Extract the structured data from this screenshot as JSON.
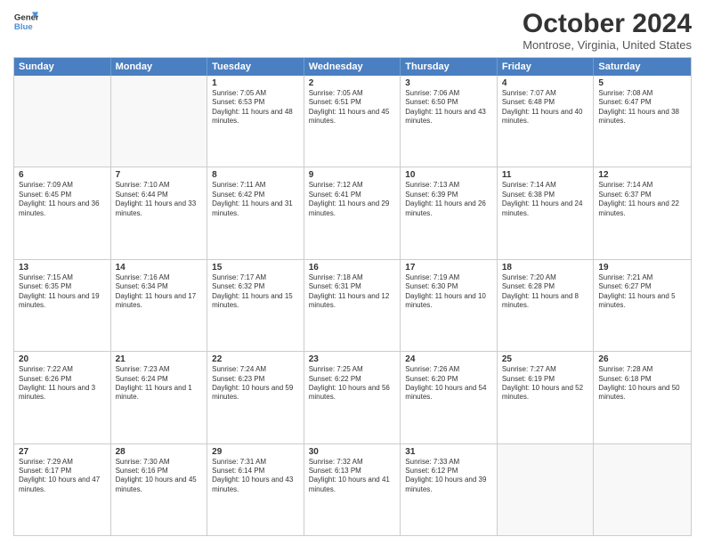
{
  "header": {
    "logo_line1": "General",
    "logo_line2": "Blue",
    "title": "October 2024",
    "subtitle": "Montrose, Virginia, United States"
  },
  "weekdays": [
    "Sunday",
    "Monday",
    "Tuesday",
    "Wednesday",
    "Thursday",
    "Friday",
    "Saturday"
  ],
  "weeks": [
    [
      {
        "day": "",
        "info": ""
      },
      {
        "day": "",
        "info": ""
      },
      {
        "day": "1",
        "info": "Sunrise: 7:05 AM\nSunset: 6:53 PM\nDaylight: 11 hours and 48 minutes."
      },
      {
        "day": "2",
        "info": "Sunrise: 7:05 AM\nSunset: 6:51 PM\nDaylight: 11 hours and 45 minutes."
      },
      {
        "day": "3",
        "info": "Sunrise: 7:06 AM\nSunset: 6:50 PM\nDaylight: 11 hours and 43 minutes."
      },
      {
        "day": "4",
        "info": "Sunrise: 7:07 AM\nSunset: 6:48 PM\nDaylight: 11 hours and 40 minutes."
      },
      {
        "day": "5",
        "info": "Sunrise: 7:08 AM\nSunset: 6:47 PM\nDaylight: 11 hours and 38 minutes."
      }
    ],
    [
      {
        "day": "6",
        "info": "Sunrise: 7:09 AM\nSunset: 6:45 PM\nDaylight: 11 hours and 36 minutes."
      },
      {
        "day": "7",
        "info": "Sunrise: 7:10 AM\nSunset: 6:44 PM\nDaylight: 11 hours and 33 minutes."
      },
      {
        "day": "8",
        "info": "Sunrise: 7:11 AM\nSunset: 6:42 PM\nDaylight: 11 hours and 31 minutes."
      },
      {
        "day": "9",
        "info": "Sunrise: 7:12 AM\nSunset: 6:41 PM\nDaylight: 11 hours and 29 minutes."
      },
      {
        "day": "10",
        "info": "Sunrise: 7:13 AM\nSunset: 6:39 PM\nDaylight: 11 hours and 26 minutes."
      },
      {
        "day": "11",
        "info": "Sunrise: 7:14 AM\nSunset: 6:38 PM\nDaylight: 11 hours and 24 minutes."
      },
      {
        "day": "12",
        "info": "Sunrise: 7:14 AM\nSunset: 6:37 PM\nDaylight: 11 hours and 22 minutes."
      }
    ],
    [
      {
        "day": "13",
        "info": "Sunrise: 7:15 AM\nSunset: 6:35 PM\nDaylight: 11 hours and 19 minutes."
      },
      {
        "day": "14",
        "info": "Sunrise: 7:16 AM\nSunset: 6:34 PM\nDaylight: 11 hours and 17 minutes."
      },
      {
        "day": "15",
        "info": "Sunrise: 7:17 AM\nSunset: 6:32 PM\nDaylight: 11 hours and 15 minutes."
      },
      {
        "day": "16",
        "info": "Sunrise: 7:18 AM\nSunset: 6:31 PM\nDaylight: 11 hours and 12 minutes."
      },
      {
        "day": "17",
        "info": "Sunrise: 7:19 AM\nSunset: 6:30 PM\nDaylight: 11 hours and 10 minutes."
      },
      {
        "day": "18",
        "info": "Sunrise: 7:20 AM\nSunset: 6:28 PM\nDaylight: 11 hours and 8 minutes."
      },
      {
        "day": "19",
        "info": "Sunrise: 7:21 AM\nSunset: 6:27 PM\nDaylight: 11 hours and 5 minutes."
      }
    ],
    [
      {
        "day": "20",
        "info": "Sunrise: 7:22 AM\nSunset: 6:26 PM\nDaylight: 11 hours and 3 minutes."
      },
      {
        "day": "21",
        "info": "Sunrise: 7:23 AM\nSunset: 6:24 PM\nDaylight: 11 hours and 1 minute."
      },
      {
        "day": "22",
        "info": "Sunrise: 7:24 AM\nSunset: 6:23 PM\nDaylight: 10 hours and 59 minutes."
      },
      {
        "day": "23",
        "info": "Sunrise: 7:25 AM\nSunset: 6:22 PM\nDaylight: 10 hours and 56 minutes."
      },
      {
        "day": "24",
        "info": "Sunrise: 7:26 AM\nSunset: 6:20 PM\nDaylight: 10 hours and 54 minutes."
      },
      {
        "day": "25",
        "info": "Sunrise: 7:27 AM\nSunset: 6:19 PM\nDaylight: 10 hours and 52 minutes."
      },
      {
        "day": "26",
        "info": "Sunrise: 7:28 AM\nSunset: 6:18 PM\nDaylight: 10 hours and 50 minutes."
      }
    ],
    [
      {
        "day": "27",
        "info": "Sunrise: 7:29 AM\nSunset: 6:17 PM\nDaylight: 10 hours and 47 minutes."
      },
      {
        "day": "28",
        "info": "Sunrise: 7:30 AM\nSunset: 6:16 PM\nDaylight: 10 hours and 45 minutes."
      },
      {
        "day": "29",
        "info": "Sunrise: 7:31 AM\nSunset: 6:14 PM\nDaylight: 10 hours and 43 minutes."
      },
      {
        "day": "30",
        "info": "Sunrise: 7:32 AM\nSunset: 6:13 PM\nDaylight: 10 hours and 41 minutes."
      },
      {
        "day": "31",
        "info": "Sunrise: 7:33 AM\nSunset: 6:12 PM\nDaylight: 10 hours and 39 minutes."
      },
      {
        "day": "",
        "info": ""
      },
      {
        "day": "",
        "info": ""
      }
    ]
  ]
}
